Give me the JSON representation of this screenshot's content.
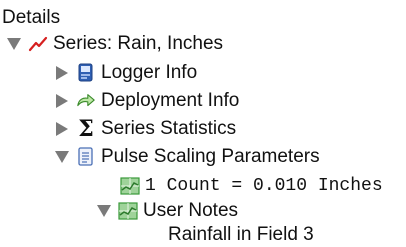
{
  "tree": {
    "root_label": "Details",
    "series": {
      "label": "Series: Rain, Inches",
      "icon": "red-line-chart-icon",
      "expanded": true,
      "children": [
        {
          "label": "Logger Info",
          "icon": "logger-device-icon",
          "expanded": false
        },
        {
          "label": "Deployment Info",
          "icon": "green-arrow-icon",
          "expanded": false
        },
        {
          "label": "Series Statistics",
          "icon": "sigma-icon",
          "expanded": false
        },
        {
          "label": "Pulse Scaling Parameters",
          "icon": "document-icon",
          "expanded": true,
          "children": [
            {
              "label": "1 Count = 0.010 Inches",
              "icon": "green-chart-icon"
            },
            {
              "label": "User Notes",
              "icon": "green-chart-icon",
              "expanded": true,
              "children": [
                {
                  "label": "Rainfall in Field 3"
                }
              ]
            }
          ]
        }
      ]
    }
  },
  "colors": {
    "text": "#111111",
    "expander": "#7a7a7a",
    "series_red": "#d62020",
    "chart_green": "#3a9a3a",
    "logger_blue": "#2f5fb3"
  }
}
